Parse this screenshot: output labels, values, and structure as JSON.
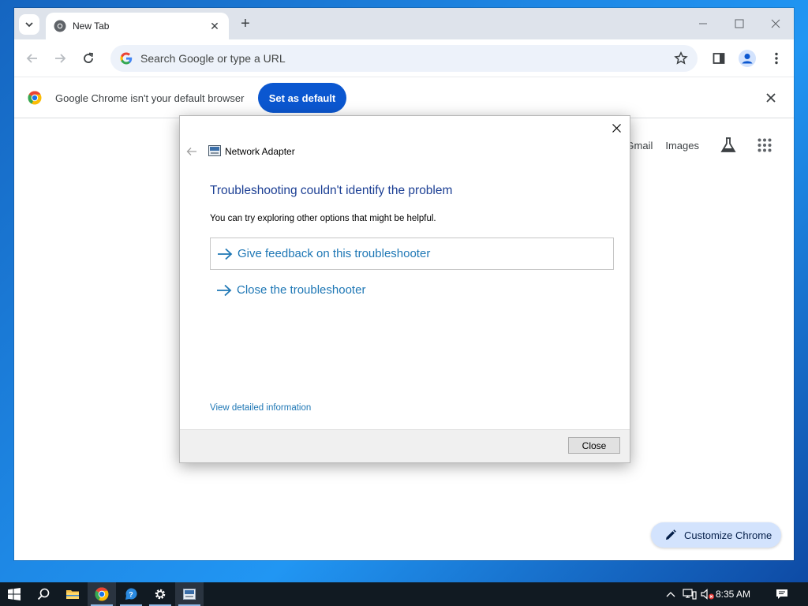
{
  "browser": {
    "tab_title": "New Tab",
    "omnibox_placeholder": "Search Google or type a URL",
    "infobar_message": "Google Chrome isn't your default browser",
    "set_default_label": "Set as default",
    "ntp_links": [
      "Gmail",
      "Images"
    ],
    "customize_label": "Customize Chrome"
  },
  "dialog": {
    "app_title": "Network Adapter",
    "heading": "Troubleshooting couldn't identify the problem",
    "subtext": "You can try exploring other options that might be helpful.",
    "options": [
      "Give feedback on this troubleshooter",
      "Close the troubleshooter"
    ],
    "details_link": "View detailed information",
    "close_button": "Close"
  },
  "taskbar": {
    "clock": "8:35 AM"
  },
  "colors": {
    "accent_blue": "#0b57d0",
    "dialog_heading": "#1c3f94",
    "dialog_link": "#1e77b5",
    "taskbar": "#111a22"
  }
}
